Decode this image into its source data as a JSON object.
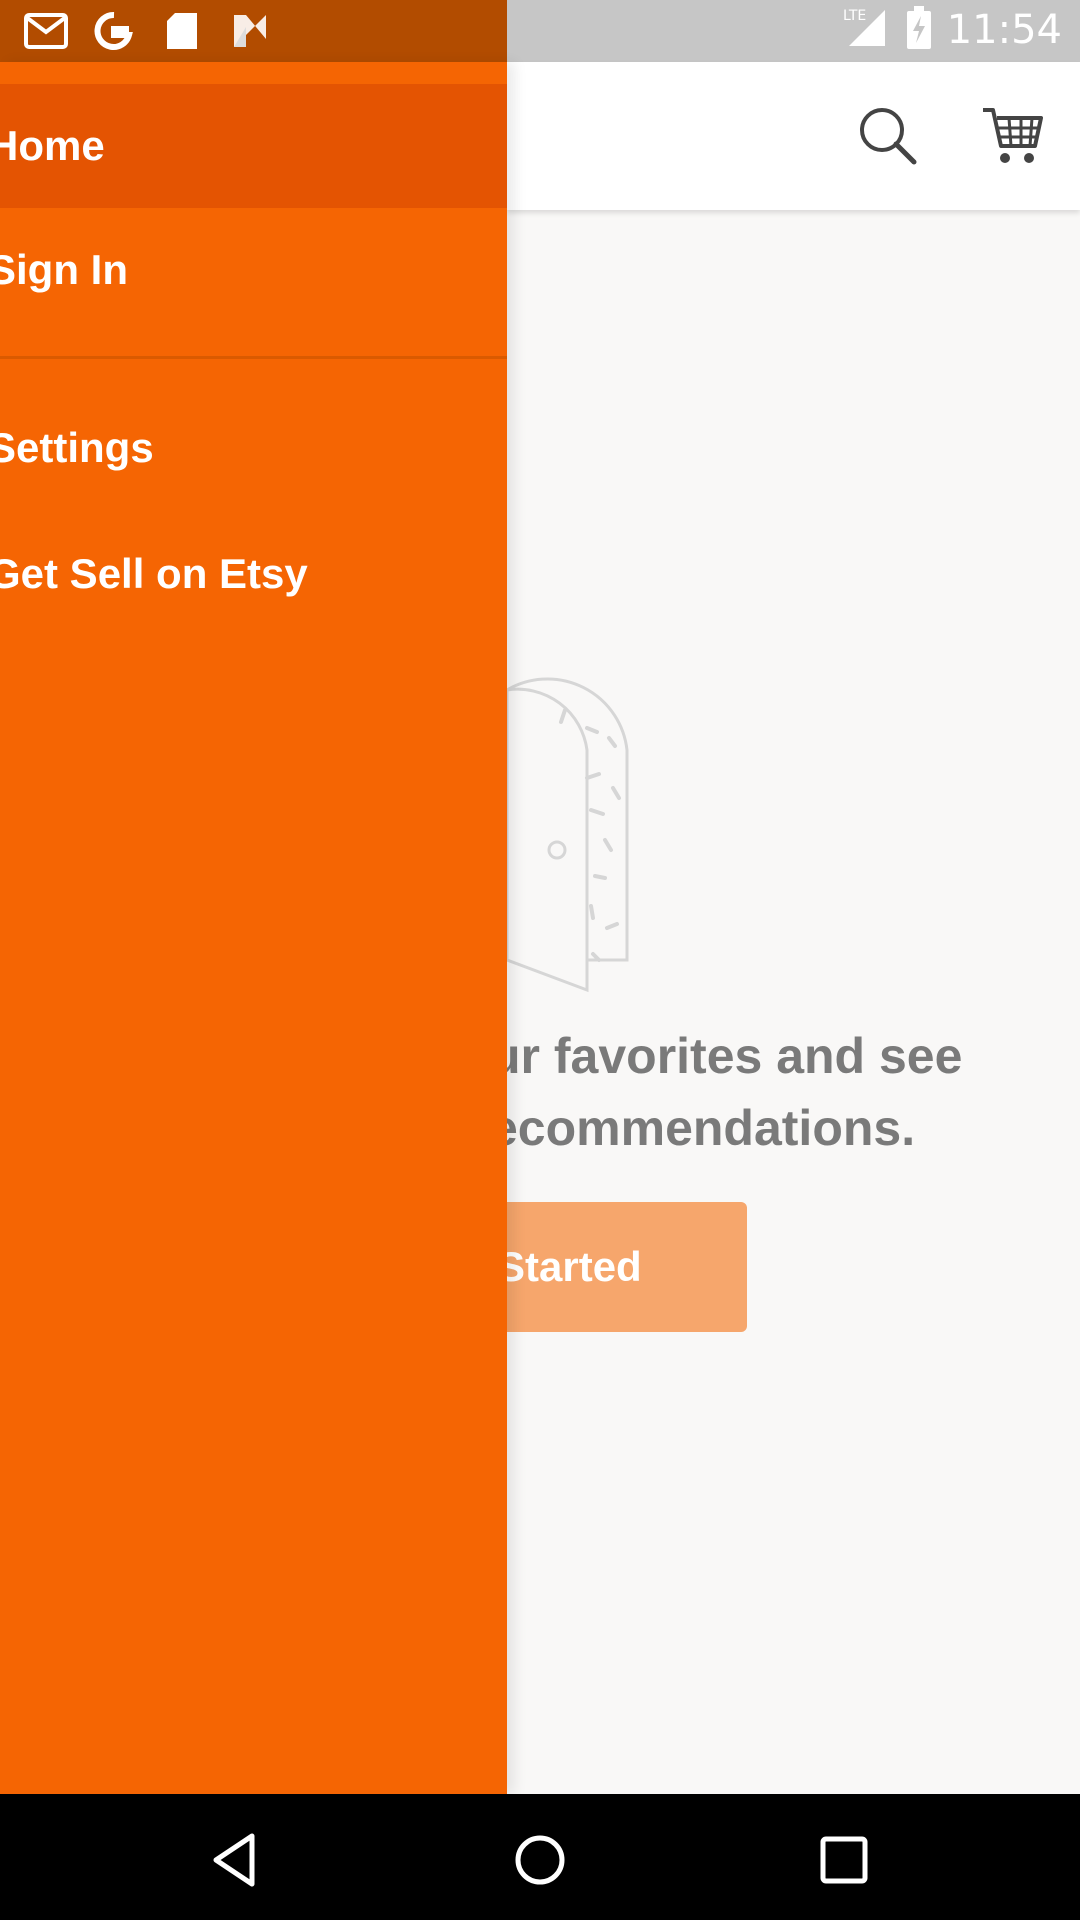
{
  "status_bar": {
    "time": "11:54",
    "network": "LTE",
    "notification_icons": [
      "gmail-icon",
      "google-icon",
      "sd-card-icon",
      "n-icon"
    ]
  },
  "drawer": {
    "items": [
      {
        "label": "Home"
      },
      {
        "label": "Sign In"
      },
      {
        "label": "Settings"
      },
      {
        "label": "Get Sell on Etsy"
      }
    ]
  },
  "main": {
    "promo_line1": "ur favorites and see",
    "promo_line2": "ecommendations.",
    "cta_label": "Started"
  },
  "colors": {
    "drawer": "#f56503",
    "drawer_active": "#e45402",
    "cta": "#f6a66c"
  }
}
